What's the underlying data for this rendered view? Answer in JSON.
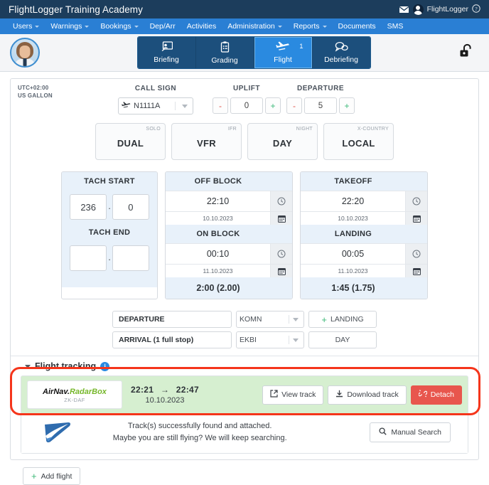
{
  "topbar": {
    "title": "FlightLogger Training Academy",
    "user": "FlightLogger",
    "mail_icon": "envelope-icon",
    "help_icon": "question-circle-icon"
  },
  "nav": {
    "items": [
      {
        "label": "Users",
        "caret": true
      },
      {
        "label": "Warnings",
        "caret": true
      },
      {
        "label": "Bookings",
        "caret": true
      },
      {
        "label": "Dep/Arr",
        "caret": false
      },
      {
        "label": "Activities",
        "caret": false
      },
      {
        "label": "Administration",
        "caret": true
      },
      {
        "label": "Reports",
        "caret": true
      },
      {
        "label": "Documents",
        "caret": false
      },
      {
        "label": "SMS",
        "caret": false
      }
    ]
  },
  "tabs": {
    "items": [
      {
        "label": "Briefing",
        "icon": "presentation-icon",
        "active": false,
        "badge": ""
      },
      {
        "label": "Grading",
        "icon": "clipboard-icon",
        "active": false,
        "badge": ""
      },
      {
        "label": "Flight",
        "icon": "airplane-icon",
        "active": true,
        "badge": "1"
      },
      {
        "label": "Debriefing",
        "icon": "speech-bubbles-icon",
        "active": false,
        "badge": ""
      }
    ],
    "lock_icon": "unlock-icon"
  },
  "form": {
    "timezone": "UTC+02:00",
    "unit": "US GALLON",
    "callsign": {
      "label": "CALL SIGN",
      "value": "N1111A",
      "icon": "airplane-icon"
    },
    "uplift": {
      "label": "UPLIFT",
      "value": "0",
      "minus": "-",
      "plus": "+"
    },
    "departure_fuel": {
      "label": "DEPARTURE",
      "value": "5",
      "minus": "-",
      "plus": "+"
    },
    "types": [
      {
        "main": "DUAL",
        "alt": "SOLO"
      },
      {
        "main": "VFR",
        "alt": "IFR"
      },
      {
        "main": "DAY",
        "alt": "NIGHT"
      },
      {
        "main": "LOCAL",
        "alt": "X-COUNTRY"
      }
    ],
    "tach": {
      "start_label": "TACH START",
      "start_whole": "236",
      "start_frac": "0",
      "end_label": "TACH END",
      "end_whole": "",
      "end_frac": "",
      "separator": "."
    },
    "block": {
      "off_label": "OFF BLOCK",
      "off_time": "22:10",
      "off_date": "10.10.2023",
      "on_label": "ON BLOCK",
      "on_time": "00:10",
      "on_date": "11.10.2023",
      "total": "2:00 (2.00)",
      "clock_icon": "clock-icon",
      "calendar_icon": "calendar-icon"
    },
    "air": {
      "takeoff_label": "TAKEOFF",
      "takeoff_time": "22:20",
      "takeoff_date": "10.10.2023",
      "landing_label": "LANDING",
      "landing_time": "00:05",
      "landing_date": "11.10.2023",
      "total": "1:45 (1.75)",
      "clock_icon": "clock-icon",
      "calendar_icon": "calendar-icon"
    },
    "route": {
      "departure_label": "DEPARTURE",
      "departure_airport": "KOMN",
      "landing_button": "LANDING",
      "arrival_label": "ARRIVAL (1 full stop)",
      "arrival_airport": "EKBI",
      "day_button": "DAY"
    }
  },
  "flight_tracking": {
    "title": "Flight tracking",
    "info_icon": "info-icon",
    "collapse_icon": "chevron-down-icon",
    "provider": {
      "logo_part1": "AirNav.",
      "logo_part2": "RadarBox",
      "registration": "ZK-DAF"
    },
    "track": {
      "start_time": "22:21",
      "arrow": "→",
      "end_time": "22:47",
      "date": "10.10.2023"
    },
    "actions": [
      {
        "label": "View track",
        "icon": "external-link-icon",
        "style": "default"
      },
      {
        "label": "Download track",
        "icon": "download-icon",
        "style": "default"
      },
      {
        "label": "Detach",
        "icon": "unlink-icon",
        "style": "danger"
      }
    ],
    "status_line1": "Track(s) successfully found and attached.",
    "status_line2": "Maybe you are still flying? We will keep searching.",
    "manual_search": {
      "label": "Manual Search",
      "icon": "search-icon"
    },
    "logo_icon": "flightlogger-swoosh-icon"
  },
  "footer": {
    "add_flight": {
      "label": "Add flight",
      "icon": "plus-icon"
    }
  },
  "colors": {
    "topbar": "#1c3d5c",
    "navbar": "#2a7fd4",
    "accent_blue": "#2a8ae0",
    "green": "#3cb878",
    "red": "#e8564d",
    "track_row_bg": "#d6efd0",
    "annotation": "#f5351b"
  }
}
